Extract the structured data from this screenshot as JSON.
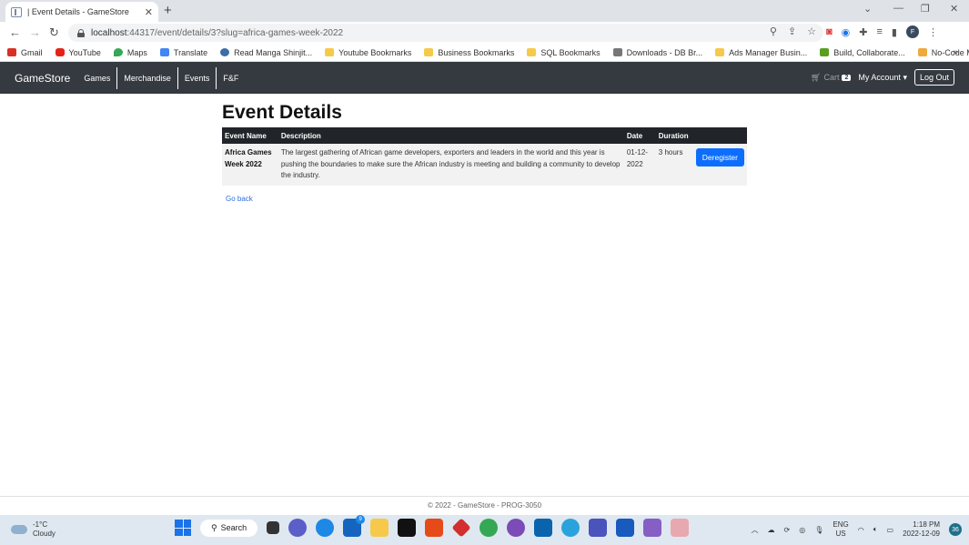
{
  "browser": {
    "tab_title": "| Event Details - GameStore",
    "url_host": "localhost",
    "url_rest": ":44317/event/details/3?slug=africa-games-week-2022",
    "bookmarks": [
      {
        "label": "Gmail",
        "icon": "gmail"
      },
      {
        "label": "YouTube",
        "icon": "yt"
      },
      {
        "label": "Maps",
        "icon": "maps"
      },
      {
        "label": "Translate",
        "icon": "trans"
      },
      {
        "label": "Read Manga Shinjit...",
        "icon": "wp"
      },
      {
        "label": "Youtube Bookmarks",
        "icon": "folder"
      },
      {
        "label": "Business Bookmarks",
        "icon": "folder"
      },
      {
        "label": "SQL Bookmarks",
        "icon": "folder"
      },
      {
        "label": "Downloads - DB Br...",
        "icon": "dl"
      },
      {
        "label": "Ads Manager Busin...",
        "icon": "folder"
      },
      {
        "label": "Build, Collaborate...",
        "icon": "green"
      },
      {
        "label": "No-Code Mobile A...",
        "icon": "nocode"
      }
    ],
    "profile_initial": "F"
  },
  "nav": {
    "brand": "GameStore",
    "links": [
      "Games",
      "Merchandise",
      "Events",
      "F&F"
    ],
    "cart_label": "Cart",
    "cart_count": "2",
    "account_label": "My Account",
    "logout_label": "Log Out"
  },
  "page": {
    "title": "Event Details",
    "columns": [
      "Event Name",
      "Description",
      "Date",
      "Duration"
    ],
    "event": {
      "name": "Africa Games Week 2022",
      "description": "The largest gathering of African game developers, exporters and leaders in the world and this year is pushing the boundaries to make sure the African industry is meeting and building a community to develop the industry.",
      "date": "01-12-2022",
      "duration": "3 hours",
      "action_label": "Deregister"
    },
    "go_back": "Go back"
  },
  "footer": {
    "text": "© 2022 - GameStore - PROG-3050"
  },
  "taskbar": {
    "temp": "-1°C",
    "weather": "Cloudy",
    "search_label": "Search",
    "mail_badge": "9",
    "lang1": "ENG",
    "lang2": "US",
    "time": "1:18 PM",
    "date": "2022-12-09",
    "notif_count": "36"
  },
  "colors": {
    "navbar": "#343a40",
    "table_header": "#212529",
    "primary": "#0d6efd",
    "link": "#2f6fde"
  }
}
